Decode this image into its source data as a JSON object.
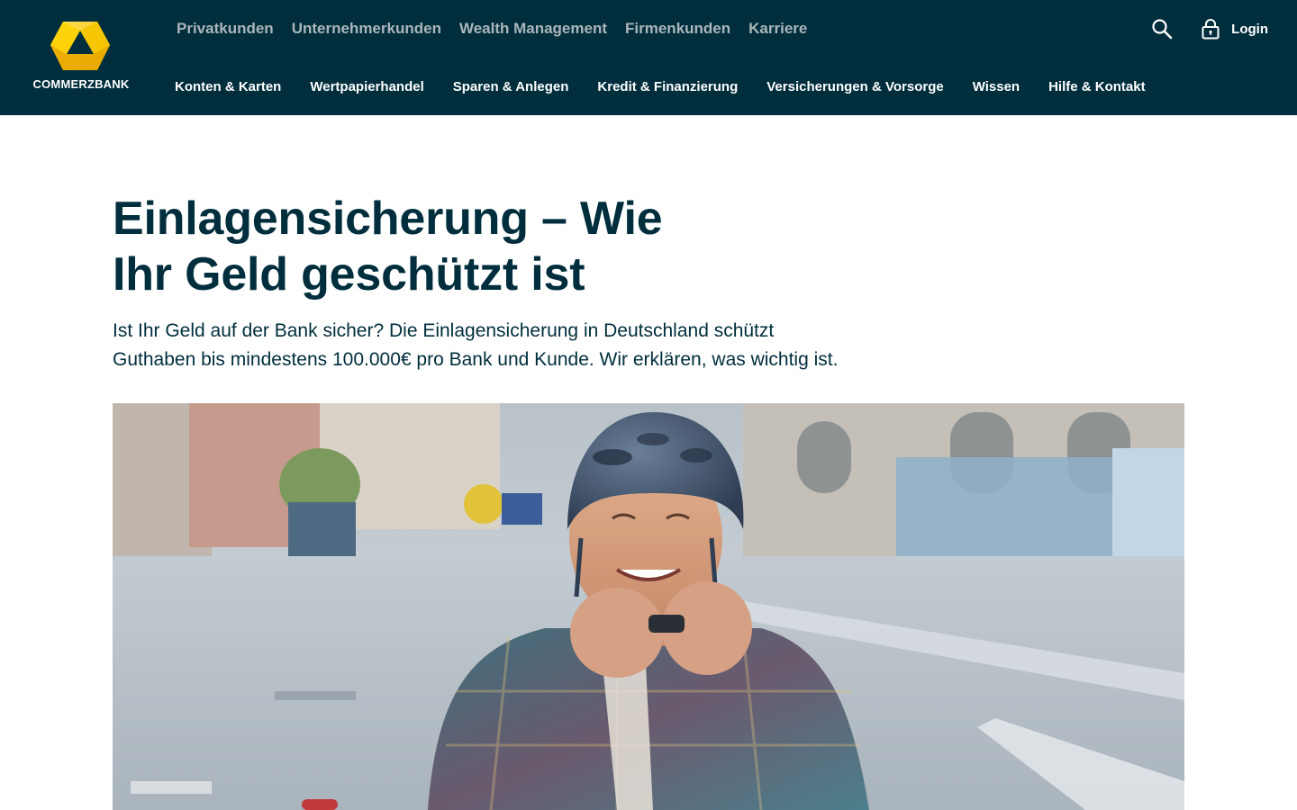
{
  "brand": {
    "name": "COMMERZBANK",
    "logo_color": "#ffd700",
    "header_bg": "#002e3c"
  },
  "segment_nav": [
    {
      "label": "Privatkunden"
    },
    {
      "label": "Unternehmerkunden"
    },
    {
      "label": "Wealth Management"
    },
    {
      "label": "Firmenkunden"
    },
    {
      "label": "Karriere"
    }
  ],
  "utilities": {
    "search_icon": "search-icon",
    "login_icon": "lock-icon",
    "login_label": "Login"
  },
  "main_nav": [
    {
      "label": "Konten & Karten"
    },
    {
      "label": "Wertpapierhandel"
    },
    {
      "label": "Sparen & Anlegen"
    },
    {
      "label": "Kredit & Finanzierung"
    },
    {
      "label": "Versicherungen & Vorsorge"
    },
    {
      "label": "Wissen"
    },
    {
      "label": "Hilfe & Kontakt"
    }
  ],
  "article": {
    "title_lines": [
      "Einlagensicherung – Wie",
      "Ihr Geld geschützt ist"
    ],
    "intro_lines": [
      "Ist Ihr Geld auf der Bank sicher? Die Einlagensicherung in Deutschland schützt",
      "Guthaben bis mindestens 100.000€ pro Bank und Kunde. Wir erklären, was wichtig ist."
    ]
  }
}
